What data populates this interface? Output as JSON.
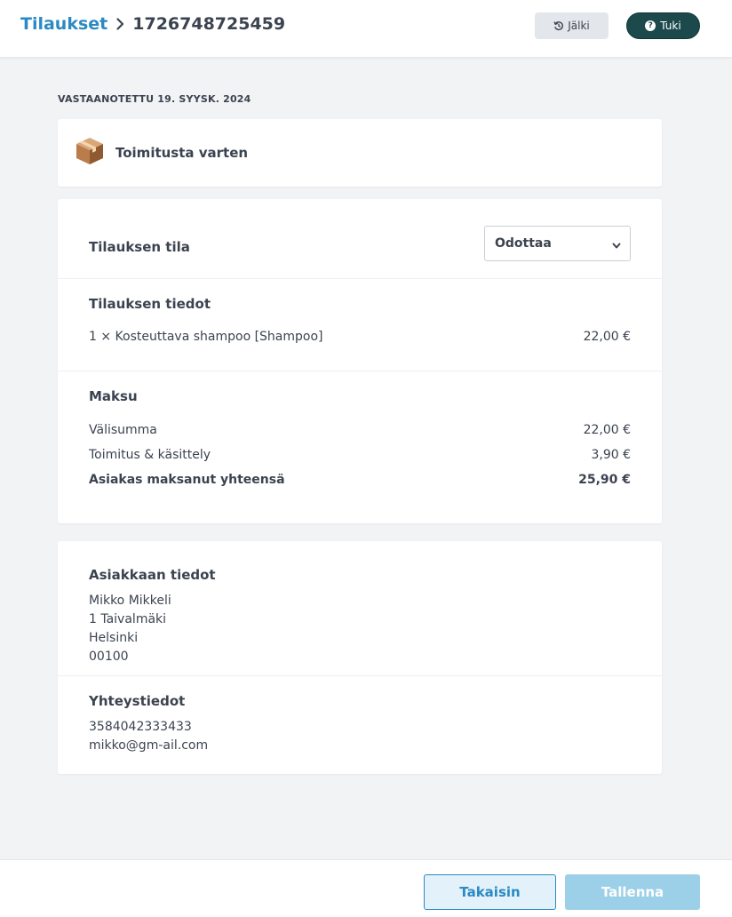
{
  "header": {
    "breadcrumb_parent": "Tilaukset",
    "breadcrumb_current": "1726748725459",
    "history_label": "Jälki",
    "support_label": "Tuki"
  },
  "order": {
    "received": "VASTAANOTETTU 19. SYYSK. 2024",
    "shipping_title": "Toimitusta varten",
    "status": {
      "label": "Tilauksen tila",
      "selected": "Odottaa"
    },
    "details": {
      "title": "Tilauksen tiedot",
      "items": [
        {
          "description": "1 × Kosteuttava shampoo [Shampoo]",
          "price": "22,00 €"
        }
      ]
    },
    "payment": {
      "title": "Maksu",
      "subtotal_label": "Välisumma",
      "subtotal_value": "22,00 €",
      "shipping_label": "Toimitus & käsittely",
      "shipping_value": "3,90 €",
      "total_label": "Asiakas maksanut yhteensä",
      "total_value": "25,90 €"
    }
  },
  "customer": {
    "title": "Asiakkaan tiedot",
    "name": "Mikko Mikkeli",
    "street": "1 Taivalmäki",
    "city": "Helsinki",
    "postal_code": "00100"
  },
  "contact": {
    "title": "Yhteystiedot",
    "phone": "3584042333433",
    "email": "mikko@gm-ail.com"
  },
  "footer": {
    "back_label": "Takaisin",
    "save_label": "Tallenna"
  },
  "colors": {
    "accent": "#2b8ac2",
    "support_button": "#1c4a4c",
    "save_disabled": "#9ccfe8",
    "background": "#f2f3f5"
  }
}
